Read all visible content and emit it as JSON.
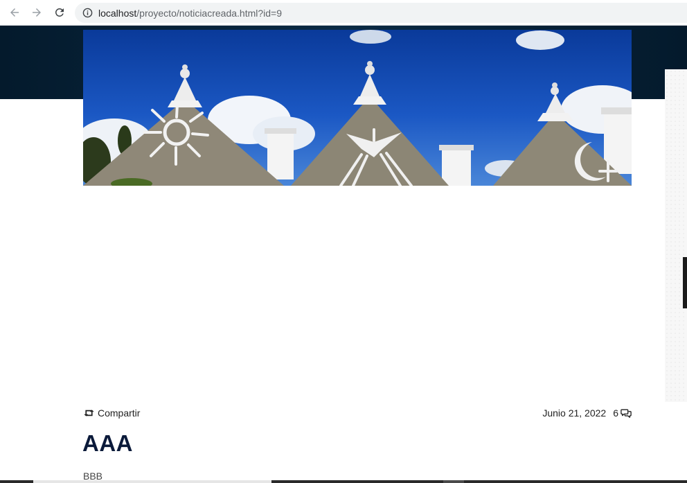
{
  "browser": {
    "url_host": "localhost",
    "url_path": "/proyecto/noticiacreada.html?id=9",
    "icons": {
      "back": "arrow-left-icon",
      "forward": "arrow-right-icon",
      "reload": "reload-icon",
      "site_info": "info-icon"
    }
  },
  "article": {
    "image_description_icon": "trulli-rooftops-image",
    "share_label": "Compartir",
    "share_icon": "retweet-icon",
    "date": "Junio 21, 2022",
    "comment_count": "6",
    "comment_icon": "comments-icon",
    "title": "AAA",
    "body": "BBB"
  },
  "colors": {
    "header_band": "#041a2c",
    "title": "#0b1a3a",
    "text": "#1f1f1f",
    "sky": "#1b58c4"
  }
}
